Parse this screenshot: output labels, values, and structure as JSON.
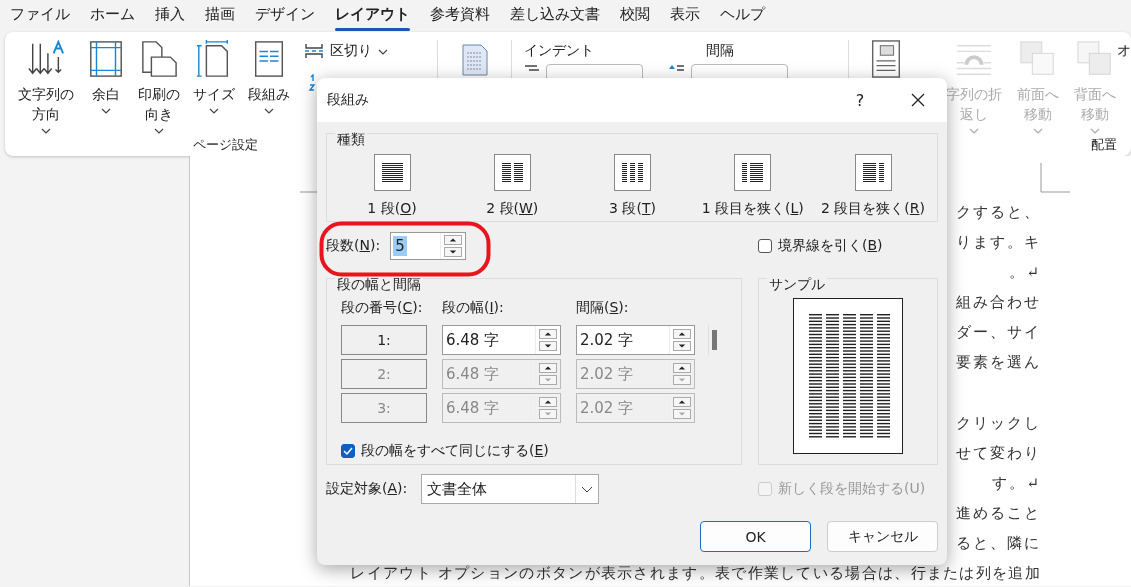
{
  "tabs": [
    {
      "label": "ファイル",
      "selected": false
    },
    {
      "label": "ホーム",
      "selected": false
    },
    {
      "label": "挿入",
      "selected": false
    },
    {
      "label": "描画",
      "selected": false
    },
    {
      "label": "デザイン",
      "selected": false
    },
    {
      "label": "レイアウト",
      "selected": true
    },
    {
      "label": "参考資料",
      "selected": false
    },
    {
      "label": "差し込み文書",
      "selected": false
    },
    {
      "label": "校閲",
      "selected": false
    },
    {
      "label": "表示",
      "selected": false
    },
    {
      "label": "ヘルプ",
      "selected": false
    }
  ],
  "ribbon": {
    "page_setup": {
      "label": "ページ設定",
      "buttons": [
        {
          "kind": "text-direction",
          "lines": [
            "文字列の",
            "方向"
          ],
          "dropdown": true
        },
        {
          "kind": "margins",
          "lines": [
            "余白"
          ],
          "dropdown": true
        },
        {
          "kind": "orientation",
          "lines": [
            "印刷の",
            "向き"
          ],
          "dropdown": true
        },
        {
          "kind": "size",
          "lines": [
            "サイズ"
          ],
          "dropdown": true
        },
        {
          "kind": "columns",
          "lines": [
            "段組み"
          ],
          "dropdown": true
        }
      ],
      "breaks": {
        "label": "区切り",
        "dropdown": true
      }
    },
    "paragraph": {
      "headings": [
        "インデント",
        "間隔"
      ]
    },
    "arrange": {
      "label": "配置",
      "buttons": [
        {
          "kind": "position",
          "disabled": false,
          "dropdown": false
        },
        {
          "kind": "wrap",
          "lines": [
            "字列の折",
            "返し"
          ],
          "disabled": true,
          "dropdown": true
        },
        {
          "kind": "front",
          "lines": [
            "前面へ",
            "移動"
          ],
          "disabled": true,
          "dropdown": true
        },
        {
          "kind": "back",
          "lines": [
            "背面へ",
            "移動"
          ],
          "disabled": true,
          "dropdown": true
        },
        {
          "kind": "object",
          "lines": [
            "オ"
          ],
          "disabled": false,
          "dropdown": false
        }
      ]
    }
  },
  "document": {
    "blocks": [
      [
        "クすると、",
        "ります。キ",
        "。↵",
        "組み合わせ",
        "ダー、サイ",
        "要素を選ん"
      ],
      [
        "クリックし",
        "せて変わり",
        "す。↵",
        "進めること",
        "ると、隣に",
        "レイアウト オプションのボタンが表示されます。表で作業している場合は、行または列を追加"
      ]
    ]
  },
  "dialog": {
    "title": "段組み",
    "help": "?",
    "presets": {
      "legend": "種類",
      "items": [
        {
          "kind": "one",
          "pre": "1 段(",
          "key": "O",
          "post": ")",
          "selected": false
        },
        {
          "kind": "two",
          "pre": "2 段(",
          "key": "W",
          "post": ")",
          "selected": false
        },
        {
          "kind": "three",
          "pre": "3 段(",
          "key": "T",
          "post": ")",
          "selected": false
        },
        {
          "kind": "left",
          "pre": "1 段目を狭く(",
          "key": "L",
          "post": ")",
          "selected": false
        },
        {
          "kind": "right",
          "pre": "2 段目を狭く(",
          "key": "R",
          "post": ")",
          "selected": false
        }
      ]
    },
    "count": {
      "pre": "段数(",
      "key": "N",
      "post": "):",
      "value": "5",
      "value_selected": true
    },
    "line_between": {
      "pre": "境界線を引く(",
      "key": "B",
      "post": ")",
      "checked": false,
      "disabled": false
    },
    "widths": {
      "legend": "段の幅と間隔",
      "headers": [
        {
          "pre": "段の番号(",
          "key": "C",
          "post": "):"
        },
        {
          "pre": "段の幅(",
          "key": "I",
          "post": "):"
        },
        {
          "pre": "間隔(",
          "key": "S",
          "post": "):"
        }
      ],
      "rows": [
        {
          "number": "1:",
          "width": "6.48 字",
          "spacing": "2.02 字",
          "disabled": false
        },
        {
          "number": "2:",
          "width": "6.48 字",
          "spacing": "2.02 字",
          "disabled": true
        },
        {
          "number": "3:",
          "width": "6.48 字",
          "spacing": "2.02 字",
          "disabled": true
        }
      ],
      "equal": {
        "pre": "段の幅をすべて同じにする(",
        "key": "E",
        "post": ")",
        "checked": true,
        "disabled": false
      }
    },
    "sample": {
      "legend": "サンプル"
    },
    "apply_to": {
      "pre": "設定対象(",
      "key": "A",
      "post": "):",
      "value": "文書全体"
    },
    "new_column": {
      "pre": "新しく段を開始する(U)",
      "checked": false,
      "disabled": true
    },
    "buttons": [
      {
        "label": "OK",
        "default": true
      },
      {
        "label": "キャンセル",
        "default": false
      }
    ]
  }
}
